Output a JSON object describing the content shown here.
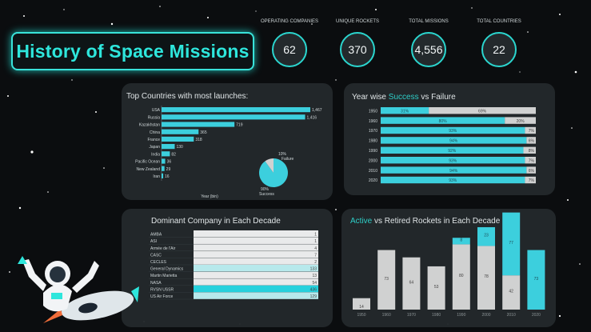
{
  "title": "History of Space Missions",
  "kpis": [
    {
      "label": "OPERATING COMPANIES",
      "value": "62"
    },
    {
      "label": "UNIQUE ROCKETS",
      "value": "370"
    },
    {
      "label": "TOTAL MISSIONS",
      "value": "4,556"
    },
    {
      "label": "TOTAL COUNTRIES",
      "value": "22"
    }
  ],
  "colors": {
    "accent": "#2ee6dc",
    "bar": "#3fd7e6",
    "panel": "#23292c",
    "grey": "#d9d9d9"
  },
  "panels": {
    "countries": {
      "title": "Top Countries with most launches:",
      "xlabel": "Year (bin)"
    },
    "success": {
      "title_pre": "Year wise ",
      "title_acc": "Success",
      "title_post": " vs Failure"
    },
    "company": {
      "title": "Dominant Company in Each Decade"
    },
    "rockets": {
      "title_acc": "Active",
      "title_post": " vs Retired Rockets in Each Decade"
    }
  },
  "chart_data": [
    {
      "type": "bar",
      "title": "Top Countries with most launches:",
      "orientation": "horizontal",
      "categories": [
        "USA",
        "Russia",
        "Kazakhstan",
        "China",
        "France",
        "Japan",
        "India",
        "Pacific Ocean",
        "New Zealand",
        "Iran"
      ],
      "values": [
        1467,
        1416,
        719,
        365,
        318,
        130,
        82,
        36,
        29,
        16
      ],
      "value_labels": [
        "1,467",
        "1,416",
        "719",
        "365",
        "318",
        "130",
        "82",
        "36",
        "29",
        "16"
      ],
      "xlabel": "Year (bin)"
    },
    {
      "type": "pie",
      "categories": [
        "Success",
        "Failure"
      ],
      "values": [
        90,
        10
      ],
      "labels": [
        "90%\nSuccess",
        "10%\nFailure"
      ]
    },
    {
      "type": "bar",
      "title": "Year wise Success vs Failure",
      "stacked": true,
      "orientation": "horizontal",
      "categories": [
        "1950",
        "1960",
        "1970",
        "1980",
        "1990",
        "2000",
        "2010",
        "2020"
      ],
      "series": [
        {
          "name": "Success",
          "values": [
            31,
            80,
            93,
            94,
            92,
            93,
            94,
            93
          ]
        },
        {
          "name": "Failure",
          "values": [
            69,
            20,
            7,
            6,
            8,
            7,
            6,
            7
          ]
        }
      ]
    },
    {
      "type": "table",
      "title": "Dominant Company in Each Decade",
      "rows": [
        {
          "company": "AMBA",
          "value": "1"
        },
        {
          "company": "ASI",
          "value": "1"
        },
        {
          "company": "Armée de l'Air",
          "value": "4"
        },
        {
          "company": "CASC",
          "value": "7"
        },
        {
          "company": "CECLES",
          "value": "2"
        },
        {
          "company": "General Dynamics",
          "value": "133"
        },
        {
          "company": "Martin Marietta",
          "value": "13"
        },
        {
          "company": "NASA",
          "value": "54"
        },
        {
          "company": "RVSN USSR",
          "value": "436"
        },
        {
          "company": "US Air Force",
          "value": "129"
        }
      ],
      "highlight": [
        5,
        8,
        9
      ]
    },
    {
      "type": "bar",
      "title": "Active vs Retired Rockets in Each Decade",
      "stacked": true,
      "categories": [
        "1950",
        "1960",
        "1970",
        "1980",
        "1990",
        "2000",
        "2010",
        "2020"
      ],
      "series": [
        {
          "name": "Retired",
          "values": [
            14,
            73,
            64,
            53,
            80,
            78,
            42,
            0
          ]
        },
        {
          "name": "Active",
          "values": [
            0,
            0,
            0,
            0,
            8,
            23,
            77,
            73
          ]
        }
      ],
      "value_labels": [
        "14",
        "73",
        "64",
        "53",
        "80",
        "78",
        "42",
        "77",
        "23",
        "73"
      ]
    }
  ]
}
